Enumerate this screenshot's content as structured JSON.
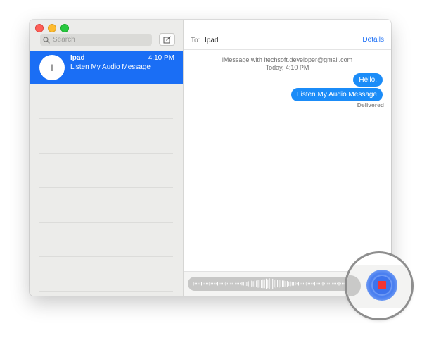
{
  "sidebar": {
    "search_placeholder": "Search",
    "conversations": [
      {
        "avatar_initial": "I",
        "name": "Ipad",
        "time": "4:10 PM",
        "preview": "Listen My Audio Message",
        "selected": true
      }
    ]
  },
  "header": {
    "to_label": "To:",
    "to_value": "Ipad",
    "details_label": "Details"
  },
  "conversation": {
    "service_line": "iMessage with itechsoft.developer@gmail.com",
    "date_line": "Today, 4:10 PM",
    "messages": [
      {
        "text": "Hello,",
        "sender": "me"
      },
      {
        "text": "Listen My Audio Message",
        "sender": "me"
      }
    ],
    "status": "Delivered"
  },
  "colors": {
    "accent_blue": "#1a6ef5",
    "bubble_blue": "#1b8cf8",
    "stop_red": "#f23434"
  },
  "icons": {
    "search": "search-icon",
    "compose": "compose-icon",
    "waveform": "audio-waveform-icon",
    "stop": "stop-recording-icon"
  }
}
